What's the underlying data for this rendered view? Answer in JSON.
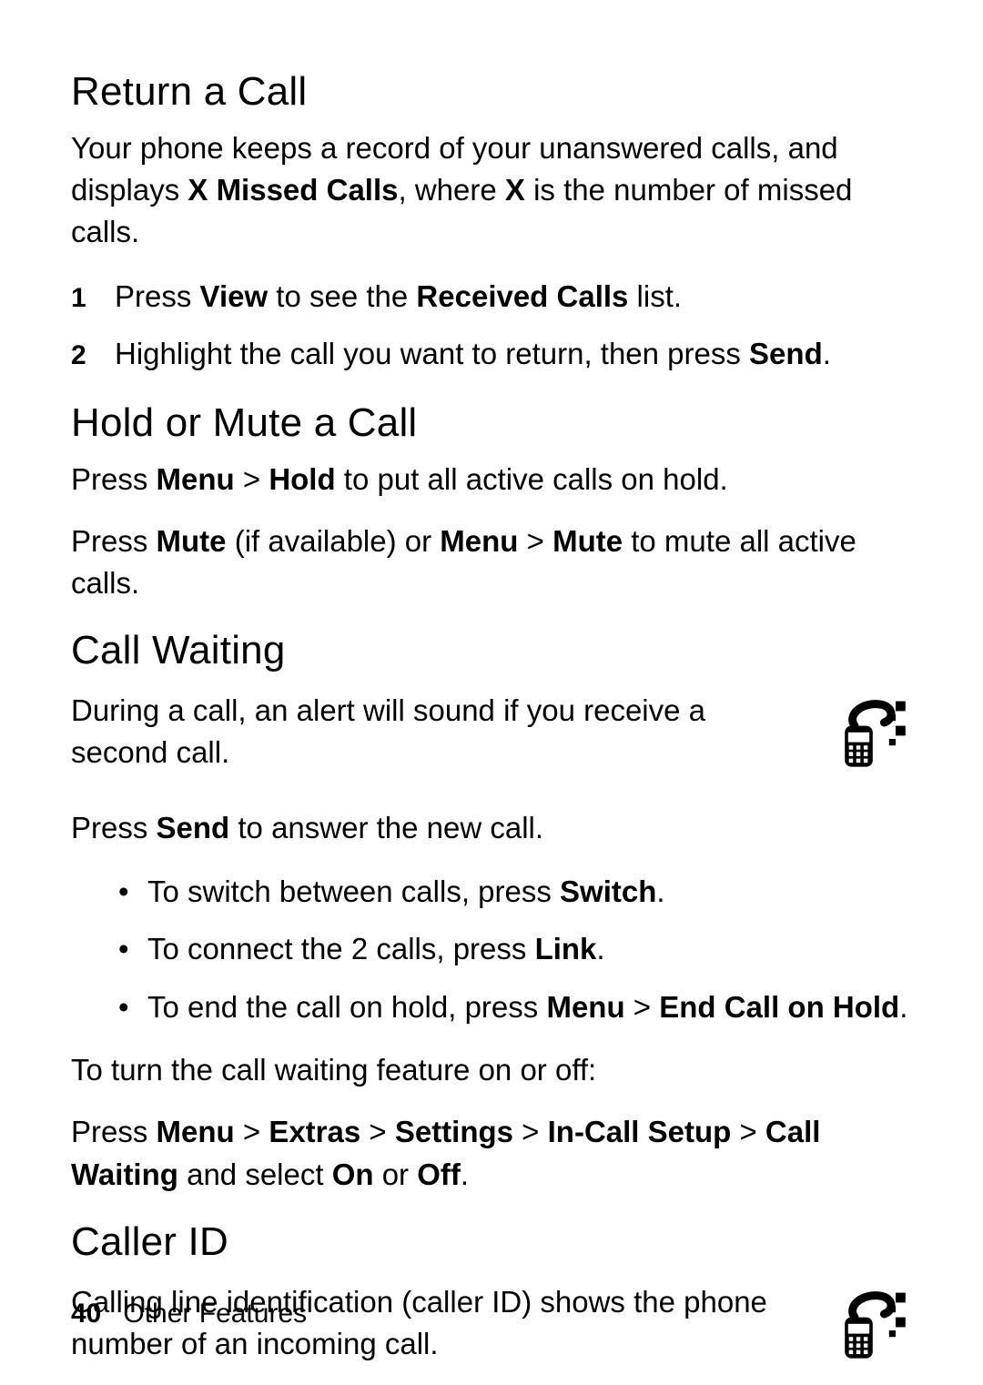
{
  "sections": {
    "return": {
      "heading": "Return a Call",
      "intro_parts": [
        "Your phone keeps a record of your unanswered calls, and displays ",
        "X Missed Calls",
        ", where ",
        "X",
        " is the number of missed calls."
      ],
      "step1_parts": [
        "Press ",
        "View",
        " to see the ",
        "Received Calls",
        " list."
      ],
      "step2_parts": [
        "Highlight the call you want to return, then press ",
        "Send",
        "."
      ],
      "num1": "1",
      "num2": "2"
    },
    "hold": {
      "heading": "Hold or Mute a Call",
      "p1_parts": [
        "Press ",
        "Menu",
        " > ",
        "Hold",
        " to put all active calls on hold."
      ],
      "p2_parts": [
        "Press ",
        "Mute",
        " (if available) or ",
        "Menu",
        " > ",
        "Mute",
        " to mute all active calls."
      ]
    },
    "cw": {
      "heading": "Call Waiting",
      "intro": "During a call, an alert will sound if you receive a second call.",
      "press_parts": [
        "Press ",
        "Send",
        " to answer the new call."
      ],
      "b1_parts": [
        "To switch between calls, press ",
        "Switch",
        "."
      ],
      "b2_parts": [
        "To connect the 2 calls, press ",
        "Link",
        "."
      ],
      "b3_parts": [
        "To end the call on hold, press ",
        "Menu",
        " > ",
        "End Call on Hold",
        "."
      ],
      "toggle_intro": "To turn the call waiting feature on or off:",
      "toggle_parts": [
        "Press ",
        "Menu",
        " > ",
        "Extras",
        " > ",
        "Settings",
        " > ",
        "In-Call Setup",
        " > ",
        "Call Waiting",
        " and select ",
        "On",
        " or ",
        "Off",
        "."
      ]
    },
    "cid": {
      "heading": "Caller ID",
      "intro": "Calling line identification (caller ID) shows the phone number of an incoming call."
    }
  },
  "footer": {
    "page": "40",
    "section": "Other Features"
  }
}
